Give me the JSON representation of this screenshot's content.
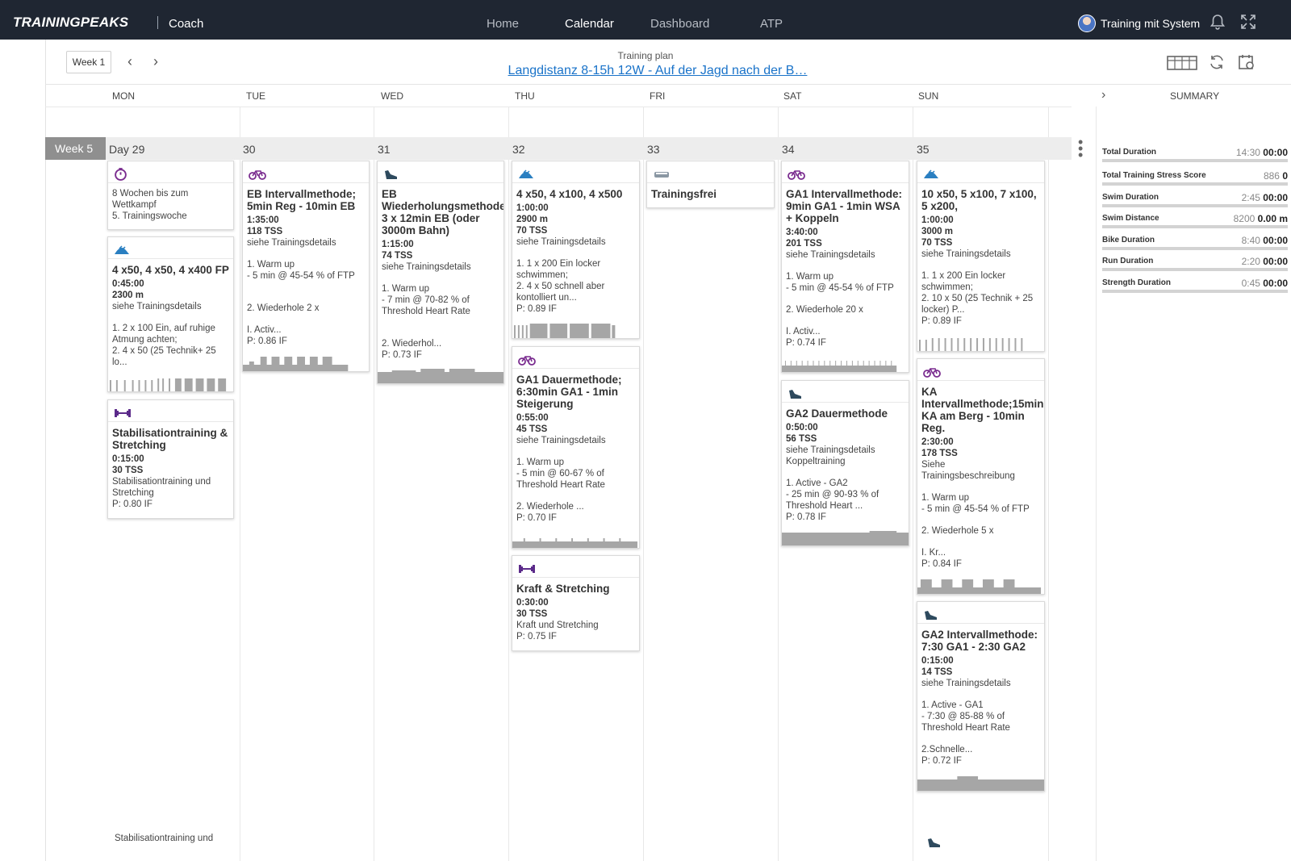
{
  "nav": {
    "logo": "TRAININGPEAKS",
    "product": "Coach",
    "items": [
      "Home",
      "Calendar",
      "Dashboard",
      "ATP"
    ],
    "active": "Calendar",
    "user_name": "Training mit System"
  },
  "plan": {
    "week_select": "Week 1",
    "caption": "Training plan",
    "title": "Langdistanz 8-15h 12W - Auf der Jagd nach der B…"
  },
  "days": [
    "MON",
    "TUE",
    "WED",
    "THU",
    "FRI",
    "SAT",
    "SUN"
  ],
  "summary_label": "SUMMARY",
  "week": {
    "label": "Week 5",
    "day_numbers": [
      "Day 29",
      "30",
      "31",
      "32",
      "33",
      "34",
      "35"
    ]
  },
  "cards": {
    "mon_event": {
      "icon": "stopwatch-icon",
      "desc": "8 Wochen bis zum\nWettkampf\n5. Trainingswoche"
    },
    "mon_swim": {
      "icon": "swim-icon",
      "title": "4 x50, 4 x50, 4 x400 FP",
      "duration": "0:45:00",
      "metric": "2300 m",
      "desc1": "siehe Trainingsdetails",
      "desc2": "1. 2 x 100 Ein, auf ruhige\nAtmung achten;\n2. 4 x 50 (25 Technik+ 25\nlo..."
    },
    "mon_strength": {
      "icon": "dumbbell-icon",
      "title": "Stabilisationtraining & Stretching",
      "duration": "0:15:00",
      "tss": "30 TSS",
      "desc1": "Stabilisationtraining und\nStretching",
      "if": "P: 0.80 IF"
    },
    "tue_bike": {
      "icon": "bike-icon",
      "title": "EB Intervallmethode; 5min Reg - 10min EB",
      "duration": "1:35:00",
      "tss": "118 TSS",
      "desc1": "siehe Trainingsdetails",
      "desc2": "1. Warm up\n- 5 min @ 45-54 % of FTP",
      "desc3": "2. Wiederhole 2 x",
      "desc4": "I. Activ...",
      "if": "P: 0.86 IF"
    },
    "wed_run": {
      "icon": "run-shoe-icon",
      "title": "EB Wiederholungsmethode: 3 x 12min EB (oder 3000m Bahn)",
      "duration": "1:15:00",
      "tss": "74 TSS",
      "desc1": "siehe Trainingsdetails",
      "desc2": "1. Warm up\n- 7 min @ 70-82 % of\nThreshold Heart Rate",
      "desc3": "2. Wiederhol...",
      "if": "P: 0.73 IF"
    },
    "thu_swim": {
      "icon": "swim-icon",
      "title": "4 x50, 4 x100, 4 x500",
      "duration": "1:00:00",
      "metric": "2900 m",
      "tss": "70 TSS",
      "desc1": "siehe Trainingsdetails",
      "desc2": "1. 1 x 200 Ein locker\nschwimmen;\n2. 4 x 50 schnell aber\nkontolliert un...",
      "if": "P: 0.89 IF"
    },
    "thu_bike": {
      "icon": "bike-icon",
      "title": "GA1 Dauermethode; 6:30min GA1 - 1min Steigerung",
      "duration": "0:55:00",
      "tss": "45 TSS",
      "desc1": "siehe Trainingsdetails",
      "desc2": "1. Warm up\n- 5 min @ 60-67 % of\nThreshold Heart Rate",
      "desc3": "2. Wiederhole ...",
      "if": "P: 0.70 IF"
    },
    "thu_strength": {
      "icon": "dumbbell-icon",
      "title": "Kraft & Stretching",
      "duration": "0:30:00",
      "tss": "30 TSS",
      "desc1": "Kraft und Stretching",
      "if": "P: 0.75 IF"
    },
    "fri_rest": {
      "icon": "rest-bed-icon",
      "title": "Trainingsfrei"
    },
    "sat_bike": {
      "icon": "bike-icon",
      "title": "GA1 Intervallmethode: 9min GA1 - 1min WSA + Koppeln",
      "duration": "3:40:00",
      "tss": "201 TSS",
      "desc1": "siehe Trainingsdetails",
      "desc2": "1. Warm up\n- 5 min @ 45-54 % of FTP",
      "desc3": "2. Wiederhole 20 x",
      "desc4": "I. Activ...",
      "if": "P: 0.74 IF"
    },
    "sat_run": {
      "icon": "run-shoe-icon",
      "title": "GA2 Dauermethode",
      "duration": "0:50:00",
      "tss": "56 TSS",
      "desc1": "siehe Trainingsdetails\nKoppeltraining",
      "desc2": "1. Active - GA2\n- 25 min @ 90-93 % of\nThreshold Heart ...",
      "if": "P: 0.78 IF"
    },
    "sun_swim": {
      "icon": "swim-icon",
      "title": "10 x50, 5 x100, 7 x100, 5 x200,",
      "duration": "1:00:00",
      "metric": "3000 m",
      "tss": "70 TSS",
      "desc1": "siehe Trainingsdetails",
      "desc2": "1. 1 x 200 Ein locker\nschwimmen;\n2. 10 x 50 (25 Technik + 25\nlocker) P...",
      "if": "P: 0.89 IF"
    },
    "sun_bike": {
      "icon": "bike-icon",
      "title": "KA Intervallmethode;15min KA am Berg - 10min Reg.",
      "duration": "2:30:00",
      "tss": "178 TSS",
      "desc1": "Siehe\nTrainingsbeschreibung",
      "desc2": "1. Warm up\n- 5 min @ 45-54 % of FTP",
      "desc3": "2. Wiederhole 5 x",
      "desc4": "I. Kr...",
      "if": "P: 0.84 IF"
    },
    "sun_run": {
      "icon": "run-shoe-icon",
      "title": "GA2 Intervallmethode: 7:30 GA1 - 2:30 GA2",
      "duration": "0:15:00",
      "tss": "14 TSS",
      "desc1": "siehe Trainingsdetails",
      "desc2": "1. Active - GA1\n- 7:30 @ 85-88 % of\nThreshold Heart Rate",
      "desc3": "2.Schnelle...",
      "if": "P: 0.72 IF"
    }
  },
  "next_week_peek": "Stabilisationtraining und",
  "summary": [
    {
      "label": "Total Duration",
      "planned": "14:30",
      "actual": "00:00"
    },
    {
      "label": "Total Training Stress Score",
      "planned": "886",
      "actual": "0"
    },
    {
      "label": "Swim Duration",
      "planned": "2:45",
      "actual": "00:00"
    },
    {
      "label": "Swim Distance",
      "planned": "8200",
      "actual": "0.00 m"
    },
    {
      "label": "Bike Duration",
      "planned": "8:40",
      "actual": "00:00"
    },
    {
      "label": "Run Duration",
      "planned": "2:20",
      "actual": "00:00"
    },
    {
      "label": "Strength Duration",
      "planned": "0:45",
      "actual": "00:00"
    }
  ],
  "colors": {
    "swim": "#2a7fc1",
    "bike": "#7a2c8f",
    "run": "#2e4a5e",
    "strength": "#5b2a8a",
    "rest": "#8a97a3",
    "link": "#1a73c9",
    "topbar": "#1f2632"
  }
}
